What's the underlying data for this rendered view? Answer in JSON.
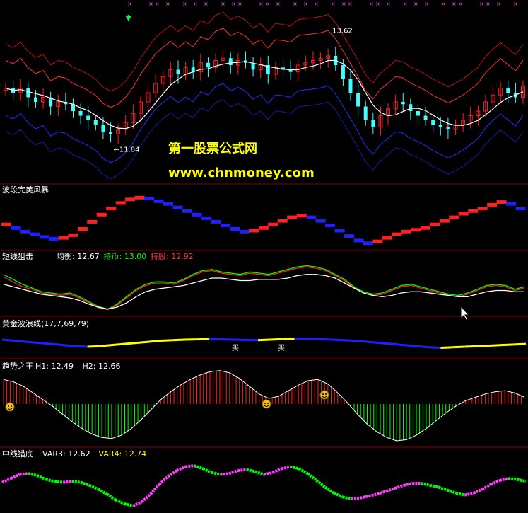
{
  "watermark": {
    "title": "第一股票公式网",
    "url": "www.chnmoney.com"
  },
  "colors": {
    "up": "#ff2020",
    "down": "#40ffff",
    "ma": "#ffffff",
    "upper1": "#ff3030",
    "upper2": "#c01010",
    "lower1": "#2030ff",
    "lower2": "#1020a0",
    "green_line": "#00ff00",
    "red_line": "#ff2020",
    "yellow": "#ffff00",
    "blue": "#2020ff",
    "magenta": "#ff40ff",
    "separator": "#8b0000",
    "signal_x": "#ff40ff",
    "arrow_down": "#00ff40",
    "label_text": "#ffffff"
  },
  "chart_data": [
    {
      "type": "candlestick",
      "panel": "main",
      "annotations": {
        "low": "←11.84",
        "high": "13.62"
      },
      "close": [
        12.9,
        12.8,
        12.9,
        12.7,
        12.6,
        12.7,
        12.5,
        12.6,
        12.55,
        12.4,
        12.3,
        12.2,
        12.1,
        11.95,
        11.9,
        12.0,
        12.15,
        12.35,
        12.6,
        12.8,
        13.0,
        13.15,
        13.3,
        13.2,
        13.35,
        13.25,
        13.45,
        13.35,
        13.5,
        13.55,
        13.4,
        13.5,
        13.45,
        13.3,
        13.4,
        13.2,
        13.35,
        13.3,
        13.25,
        13.4,
        13.45,
        13.5,
        13.55,
        13.6,
        13.4,
        13.1,
        12.8,
        12.5,
        12.2,
        12.05,
        12.3,
        12.45,
        12.6,
        12.55,
        12.4,
        12.3,
        12.2,
        12.1,
        12.05,
        12.0,
        12.1,
        12.2,
        12.3,
        12.4,
        12.6,
        12.75,
        12.9,
        12.8,
        12.7,
        12.95
      ]
    },
    {
      "type": "histogram",
      "panel": "wave",
      "label": "波段完美风暴",
      "values": [
        -0.5,
        -0.9,
        -1.3,
        -1.6,
        -1.9,
        -2.1,
        -2.0,
        -1.7,
        -1.0,
        -0.2,
        0.6,
        1.3,
        1.9,
        2.3,
        2.5,
        2.4,
        2.1,
        1.8,
        1.4,
        1.0,
        0.6,
        0.2,
        -0.2,
        -0.6,
        -1.0,
        -1.3,
        -1.2,
        -0.9,
        -0.5,
        -0.1,
        0.3,
        0.5,
        0.3,
        -0.1,
        -0.6,
        -1.2,
        -1.8,
        -2.3,
        -2.6,
        -2.4,
        -2.0,
        -1.6,
        -1.3,
        -1.1,
        -0.9,
        -0.5,
        -0.1,
        0.3,
        0.7,
        1.0,
        1.3,
        1.7,
        2.0,
        1.8,
        1.3
      ]
    },
    {
      "type": "line",
      "panel": "short",
      "label": "短线狙击",
      "legend": [
        {
          "text": "均衡: 12.67",
          "color": "#ffffff"
        },
        {
          "text": "持币: 13.00",
          "color": "#00ff00"
        },
        {
          "text": "持股: 12.92",
          "color": "#ff3030"
        }
      ],
      "series": [
        {
          "values": [
            13.3,
            13.1,
            12.9,
            12.75,
            12.6,
            12.55,
            12.5,
            12.55,
            12.4,
            12.2,
            12.0,
            11.9,
            12.1,
            12.4,
            12.7,
            12.9,
            13.0,
            13.0,
            12.95,
            13.1,
            13.3,
            13.45,
            13.5,
            13.4,
            13.35,
            13.3,
            13.4,
            13.35,
            13.3,
            13.4,
            13.5,
            13.6,
            13.65,
            13.6,
            13.5,
            13.3,
            13.1,
            12.8,
            12.6,
            12.5,
            12.55,
            12.7,
            12.85,
            12.9,
            12.8,
            12.7,
            12.6,
            12.5,
            12.45,
            12.55,
            12.7,
            12.85,
            12.9,
            12.85,
            12.7,
            12.8
          ]
        },
        {
          "values": [
            13.2,
            13.0,
            12.8,
            12.7,
            12.55,
            12.5,
            12.45,
            12.5,
            12.35,
            12.15,
            11.95,
            11.88,
            12.05,
            12.35,
            12.65,
            12.85,
            12.95,
            12.95,
            12.9,
            13.05,
            13.25,
            13.4,
            13.45,
            13.35,
            13.3,
            13.25,
            13.35,
            13.3,
            13.25,
            13.35,
            13.45,
            13.55,
            13.6,
            13.55,
            13.45,
            13.25,
            13.05,
            12.75,
            12.55,
            12.45,
            12.5,
            12.65,
            12.8,
            12.85,
            12.75,
            12.65,
            12.55,
            12.45,
            12.4,
            12.5,
            12.65,
            12.8,
            12.85,
            12.8,
            12.65,
            12.75
          ]
        },
        {
          "values": [
            12.9,
            12.8,
            12.7,
            12.6,
            12.5,
            12.45,
            12.4,
            12.35,
            12.25,
            12.1,
            11.98,
            11.9,
            11.98,
            12.15,
            12.4,
            12.6,
            12.7,
            12.75,
            12.8,
            12.85,
            12.95,
            13.05,
            13.15,
            13.15,
            13.1,
            13.05,
            13.05,
            13.1,
            13.1,
            13.1,
            13.15,
            13.25,
            13.3,
            13.3,
            13.25,
            13.15,
            12.95,
            12.75,
            12.55,
            12.45,
            12.4,
            12.45,
            12.55,
            12.6,
            12.6,
            12.55,
            12.5,
            12.45,
            12.4,
            12.4,
            12.5,
            12.6,
            12.65,
            12.65,
            12.6,
            12.6
          ]
        }
      ]
    },
    {
      "type": "line",
      "panel": "golden",
      "label": "黄金波浪线(17,7,69,79)",
      "signals": [
        "买",
        "买"
      ],
      "values": [
        0.4,
        0.2,
        0.0,
        -0.2,
        -0.4,
        -0.6,
        -0.8,
        -0.9,
        -0.8,
        -0.6,
        -0.4,
        -0.2,
        0.0,
        0.2,
        0.3,
        0.4,
        0.45,
        0.5,
        0.45,
        0.4,
        0.35,
        0.3,
        0.4,
        0.5,
        0.6,
        0.55,
        0.5,
        0.4,
        0.3,
        0.2,
        0.0,
        -0.2,
        -0.4,
        -0.6,
        -0.8,
        -1.0,
        -1.1,
        -1.0,
        -0.9,
        -0.8,
        -0.7,
        -0.6,
        -0.5,
        -0.4
      ]
    },
    {
      "type": "histogram",
      "panel": "trend",
      "label": "趋势之王",
      "legend": [
        {
          "text": "H1: 12.49",
          "color": "#ffffff"
        },
        {
          "text": "H2: 12.66",
          "color": "#ffffff"
        }
      ],
      "values": [
        2.2,
        2.0,
        1.6,
        1.0,
        0.4,
        -0.2,
        -0.9,
        -1.6,
        -2.2,
        -2.7,
        -3.0,
        -3.1,
        -2.8,
        -2.2,
        -1.4,
        -0.5,
        0.4,
        1.1,
        1.7,
        2.2,
        2.6,
        2.9,
        3.0,
        2.8,
        2.3,
        1.6,
        0.9,
        0.5,
        0.7,
        1.2,
        1.7,
        2.1,
        2.2,
        1.8,
        1.0,
        0.1,
        -0.9,
        -1.8,
        -2.5,
        -3.0,
        -3.3,
        -3.2,
        -2.8,
        -2.2,
        -1.5,
        -0.8,
        -0.2,
        0.3,
        0.6,
        0.9,
        1.1,
        1.2,
        1.0,
        0.6
      ]
    },
    {
      "type": "line",
      "panel": "mid",
      "label": "中线猎底",
      "legend": [
        {
          "text": "VAR3: 12.62",
          "color": "#ffffff"
        },
        {
          "text": "VAR4: 12.74",
          "color": "#ffff00"
        }
      ],
      "values": [
        0.2,
        0.6,
        1.0,
        1.1,
        0.9,
        0.5,
        0.3,
        0.2,
        0.3,
        0.2,
        -0.1,
        -0.5,
        -1.0,
        -1.6,
        -2.0,
        -2.2,
        -1.8,
        -1.0,
        0.0,
        0.8,
        1.4,
        1.8,
        1.9,
        1.6,
        1.2,
        1.0,
        1.1,
        1.4,
        1.5,
        1.3,
        1.0,
        1.2,
        1.6,
        1.8,
        1.6,
        1.1,
        0.4,
        -0.3,
        -0.9,
        -1.3,
        -1.5,
        -1.4,
        -1.2,
        -1.0,
        -0.7,
        -0.4,
        -0.1,
        0.1,
        0.1,
        -0.1,
        -0.3,
        -0.6,
        -0.9,
        -1.1,
        -0.9,
        -0.5,
        0.0,
        0.4,
        0.6,
        0.5,
        0.3
      ]
    }
  ]
}
